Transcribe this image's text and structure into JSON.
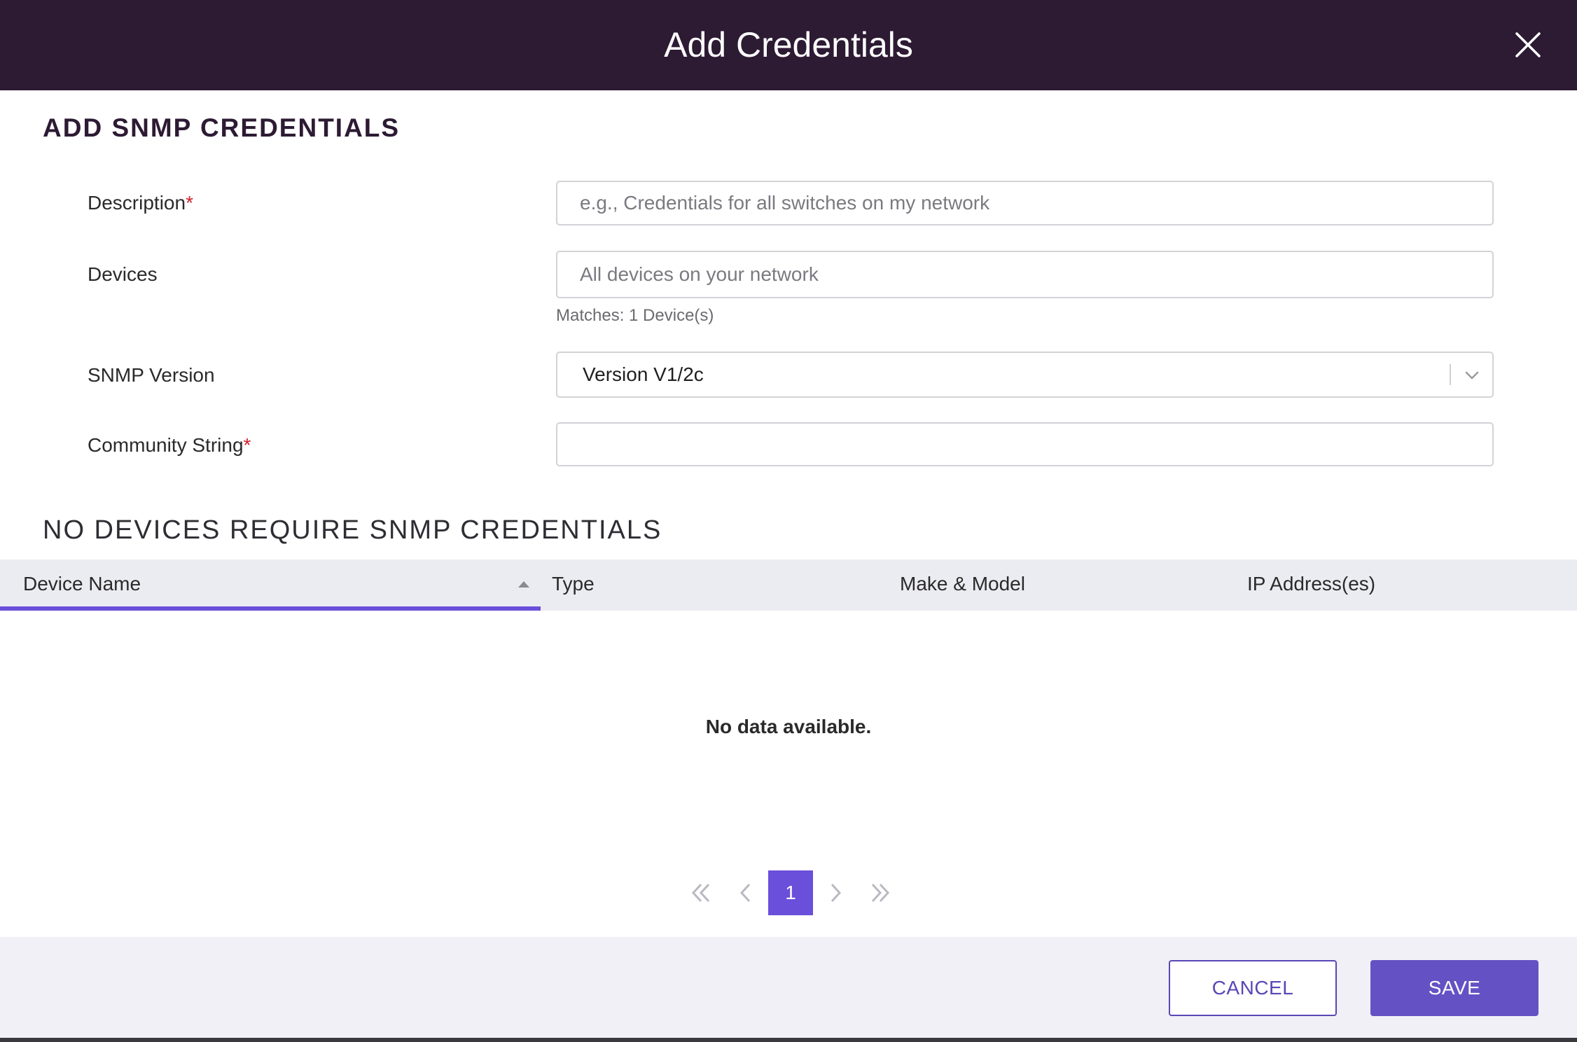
{
  "dialog": {
    "title": "Add Credentials",
    "close_icon": "close-icon"
  },
  "form": {
    "section_title": "ADD SNMP CREDENTIALS",
    "description": {
      "label": "Description",
      "required_mark": "*",
      "value": "",
      "placeholder": "e.g., Credentials for all switches on my network"
    },
    "devices": {
      "label": "Devices",
      "value": "",
      "placeholder": "All devices on your network",
      "hint": "Matches: 1 Device(s)"
    },
    "snmp_version": {
      "label": "SNMP Version",
      "selected": "Version V1/2c",
      "icon": "chevron-down-icon"
    },
    "community_string": {
      "label": "Community String",
      "required_mark": "*",
      "value": "",
      "placeholder": ""
    }
  },
  "devices_table": {
    "section_title": "NO DEVICES REQUIRE SNMP CREDENTIALS",
    "columns": [
      "Device Name",
      "Type",
      "Make & Model",
      "IP Address(es)"
    ],
    "sorted_column": "Device Name",
    "sort_icon": "sort-up-icon",
    "rows": [],
    "empty_message": "No data available."
  },
  "pagination": {
    "current_page": "1",
    "icons": [
      "first-page-icon",
      "previous-page-icon",
      "next-page-icon",
      "last-page-icon"
    ]
  },
  "footer": {
    "cancel_label": "CANCEL",
    "save_label": "SAVE"
  },
  "colors": {
    "header_bg": "#2d1a33",
    "accent": "#6a4fdb",
    "save_bg": "#6452c4",
    "required": "#d0202a",
    "table_head_bg": "#ebebf2",
    "footer_bg": "#f0f0f6"
  }
}
